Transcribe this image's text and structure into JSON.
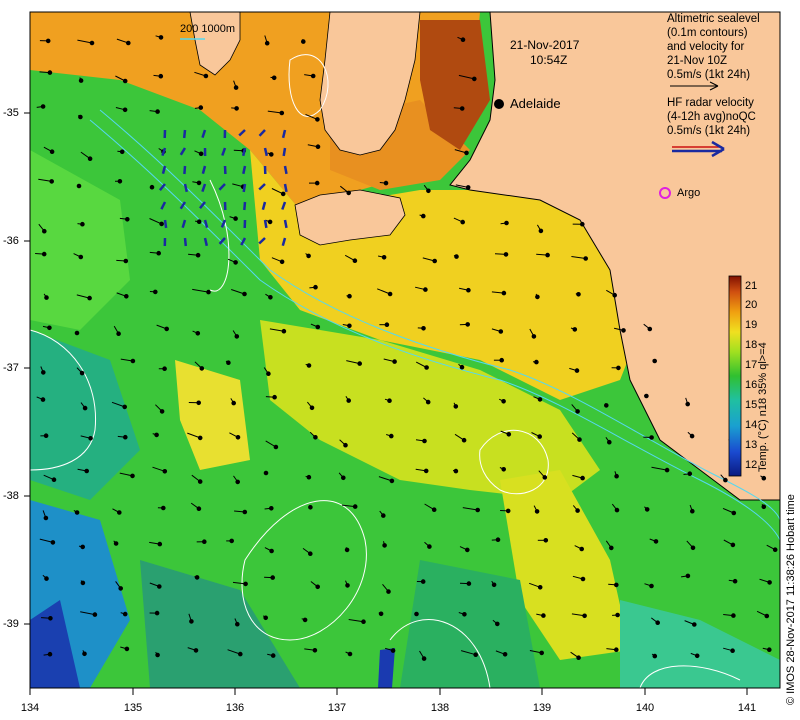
{
  "map": {
    "datetime": "21-Nov-2017",
    "time": "10:54Z",
    "scale_bar_label": "200  1000m",
    "city_label": "Adelaide",
    "argo_label": "Argo",
    "x_ticks": [
      "134",
      "135",
      "136",
      "137",
      "138",
      "139",
      "140",
      "141"
    ],
    "y_ticks": [
      "-35",
      "-36",
      "-37",
      "-38",
      "-39"
    ],
    "legend_altimetry": [
      "Altimetric sealevel",
      "(0.1m contours)",
      "and velocity for",
      "21-Nov 10Z",
      "0.5m/s (1kt 24h)"
    ],
    "legend_radar": [
      "HF radar velocity",
      "(4-12h avg)noQC",
      "0.5m/s (1kt 24h)"
    ],
    "colorbar_ticks": [
      "21",
      "20",
      "19",
      "18",
      "17",
      "16",
      "15",
      "14",
      "13",
      "12"
    ],
    "colorbar_title": "Temp. (°C) n18 35% ql>=4",
    "credit": "© IMOS 28-Nov-2017 11:38:26 Hobart time",
    "colors": {
      "land": "#f9c79a",
      "coast": "#000000",
      "argo": "#e020e0",
      "radar": "#1a2aa0",
      "radar_red": "#cc1111"
    }
  }
}
